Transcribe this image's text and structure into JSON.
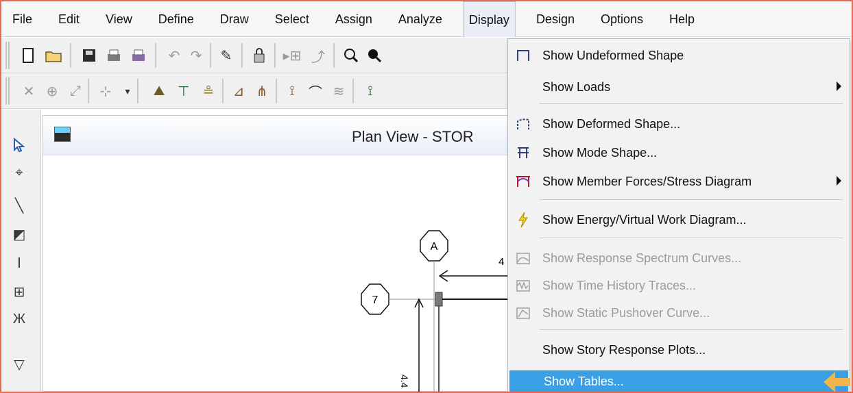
{
  "menubar": {
    "items": [
      {
        "label": "File"
      },
      {
        "label": "Edit"
      },
      {
        "label": "View"
      },
      {
        "label": "Define"
      },
      {
        "label": "Draw"
      },
      {
        "label": "Select"
      },
      {
        "label": "Assign"
      },
      {
        "label": "Analyze"
      },
      {
        "label": "Display"
      },
      {
        "label": "Design"
      },
      {
        "label": "Options"
      },
      {
        "label": "Help"
      }
    ]
  },
  "plan_window": {
    "title": "Plan View - STOR"
  },
  "plan_drawing": {
    "grid_bubble_a": "A",
    "grid_bubble_7": "7",
    "dimension_label": "4.4",
    "partial_label": "4"
  },
  "display_menu": {
    "items": [
      {
        "label": "Show Undeformed Shape",
        "has_submenu": false,
        "enabled": true,
        "icon": "undeformed-shape-icon"
      },
      {
        "label": "Show Loads",
        "has_submenu": true,
        "enabled": true,
        "icon": "none"
      },
      {
        "label": "Show Deformed Shape...",
        "has_submenu": false,
        "enabled": true,
        "icon": "deformed-shape-icon"
      },
      {
        "label": "Show Mode Shape...",
        "has_submenu": false,
        "enabled": true,
        "icon": "mode-shape-icon"
      },
      {
        "label": "Show Member Forces/Stress Diagram",
        "has_submenu": true,
        "enabled": true,
        "icon": "member-forces-icon"
      },
      {
        "label": "Show Energy/Virtual Work Diagram...",
        "has_submenu": false,
        "enabled": true,
        "icon": "energy-icon"
      },
      {
        "label": "Show Response Spectrum Curves...",
        "has_submenu": false,
        "enabled": false,
        "icon": "response-spectrum-icon"
      },
      {
        "label": "Show Time History Traces...",
        "has_submenu": false,
        "enabled": false,
        "icon": "time-history-icon"
      },
      {
        "label": "Show Static Pushover Curve...",
        "has_submenu": false,
        "enabled": false,
        "icon": "pushover-icon"
      },
      {
        "label": "Show Story Response Plots...",
        "has_submenu": false,
        "enabled": true,
        "icon": "none"
      },
      {
        "label": "Show Tables...",
        "has_submenu": false,
        "enabled": true,
        "icon": "none",
        "highlighted": true
      }
    ]
  },
  "colors": {
    "menu_highlight": "#3aa0e6",
    "frame": "#e66a4f",
    "pointer": "#f2b44b"
  }
}
